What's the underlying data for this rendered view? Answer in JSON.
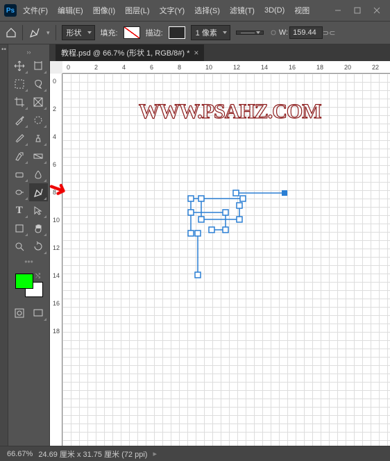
{
  "app": {
    "logo": "Ps"
  },
  "menu": [
    "文件(F)",
    "编辑(E)",
    "图像(I)",
    "图层(L)",
    "文字(Y)",
    "选择(S)",
    "滤镜(T)",
    "3D(D)",
    "视图"
  ],
  "options": {
    "mode": "形状",
    "fill_label": "填充:",
    "stroke_label": "描边:",
    "stroke_size": "1 像素",
    "width_label": "W:",
    "width_value": "159.44"
  },
  "toolbox": {
    "tools": [
      [
        "move",
        "artboard"
      ],
      [
        "marquee-rect",
        "lasso"
      ],
      [
        "crop",
        "slice"
      ],
      [
        "eyedropper",
        "marquee-ellipse"
      ],
      [
        "brush",
        "clone-stamp"
      ],
      [
        "eraser",
        "gradient"
      ],
      [
        "rect",
        "blur"
      ],
      [
        "dodge",
        "pen"
      ],
      [
        "type",
        "path-select"
      ],
      [
        "shape",
        "hand"
      ],
      [
        "zoom",
        "rotate"
      ]
    ],
    "active": "pen"
  },
  "tab": {
    "title": "教程.psd @ 66.7% (形状 1, RGB/8#) *"
  },
  "ruler_h": [
    0,
    2,
    4,
    6,
    8,
    10,
    12,
    14,
    16,
    18,
    20,
    22
  ],
  "ruler_v": [
    0,
    2,
    4,
    6,
    8,
    10,
    12,
    14,
    16,
    18
  ],
  "watermark": "WWW.PSAHZ.COM",
  "status": {
    "zoom": "66.67%",
    "doc": "24.69 厘米 x 31.75 厘米 (72 ppi)"
  }
}
